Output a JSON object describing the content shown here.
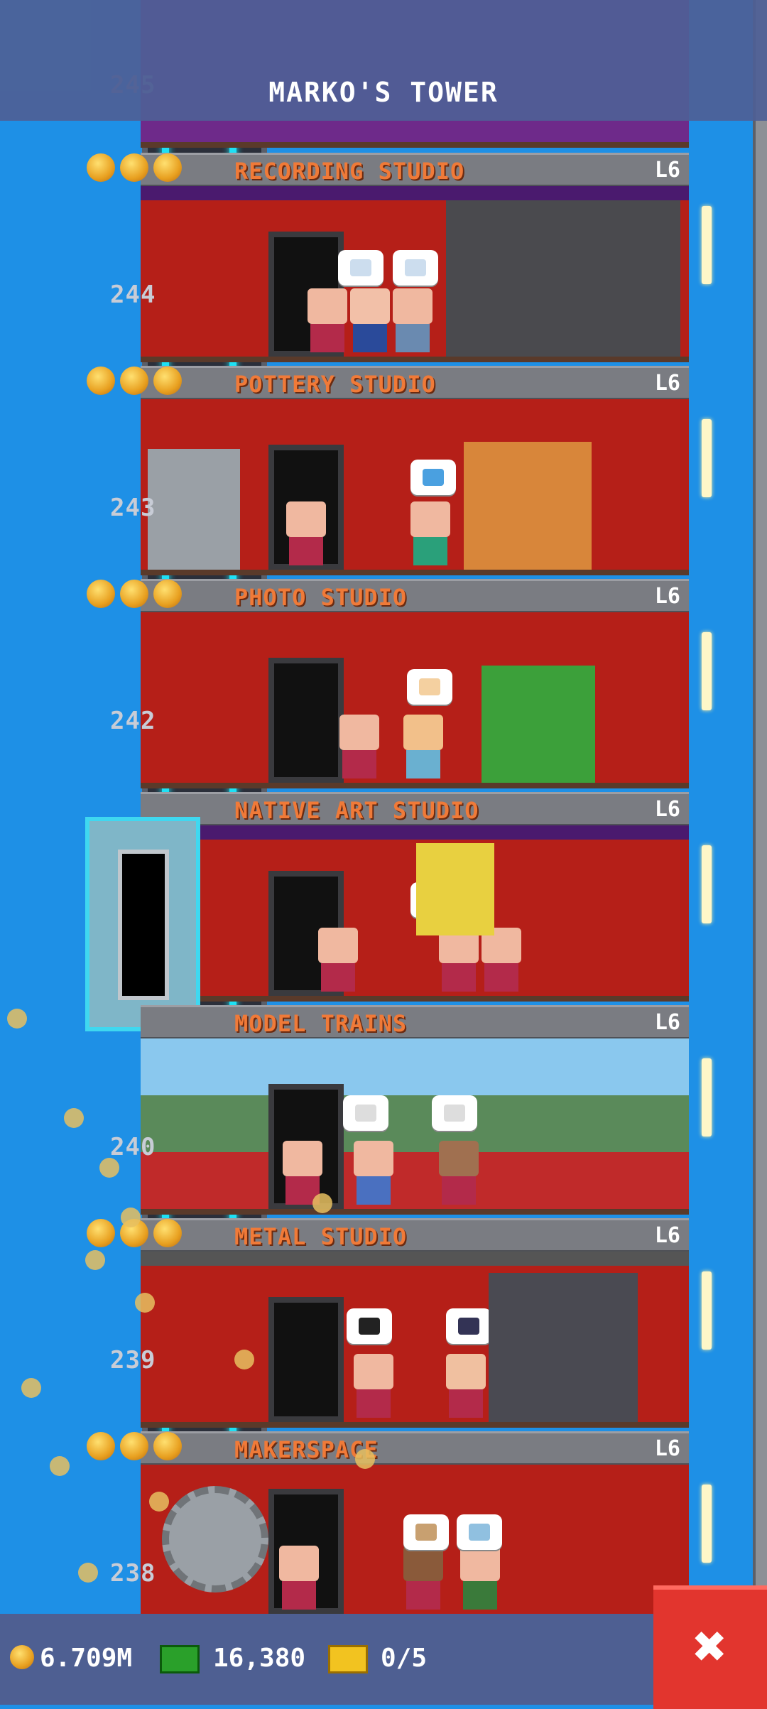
{
  "header": {
    "title": "MARKO'S TOWER"
  },
  "floors": [
    {
      "name": "RECORDING STUDIO",
      "level": "L6",
      "number": "245"
    },
    {
      "name": "POTTERY STUDIO",
      "level": "L6",
      "number": "244"
    },
    {
      "name": "PHOTO STUDIO",
      "level": "L6",
      "number": "243"
    },
    {
      "name": "NATIVE ART STUDIO",
      "level": "L6",
      "number": "242"
    },
    {
      "name": "MODEL TRAINS",
      "level": "L6",
      "number": ""
    },
    {
      "name": "METAL STUDIO",
      "level": "L6",
      "number": "240"
    },
    {
      "name": "MAKERSPACE",
      "level": "L6",
      "number": "239"
    },
    {
      "name": "",
      "level": "",
      "number": "238"
    }
  ],
  "footer": {
    "coins": "6.709M",
    "bux": "16,380",
    "tickets": "0/5",
    "close_icon": "close-icon"
  },
  "colors": {
    "accent": "#f07a38",
    "sky": "#1e90e6",
    "bar": "#4e5f92",
    "close": "#e2352e"
  }
}
